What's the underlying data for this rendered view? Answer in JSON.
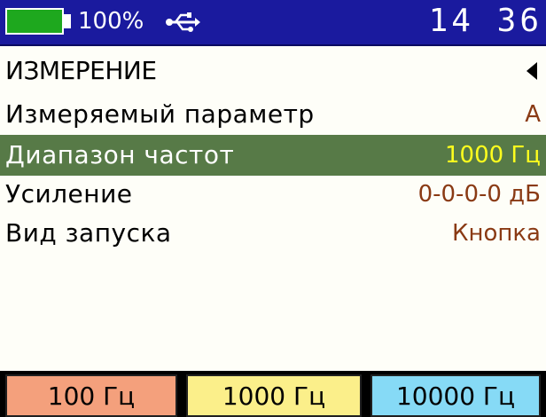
{
  "status_bar": {
    "battery_percent": "100%",
    "battery_level": 1.0,
    "usb_icon": "usb-icon",
    "clock": "14 36",
    "colors": {
      "background": "#1a1a9e",
      "battery": "#1ea81e"
    }
  },
  "menu": {
    "title": "ИЗМЕРЕНИЕ",
    "back_icon": "triangle-left-icon",
    "items": [
      {
        "label": "Измеряемый параметр",
        "value": "A",
        "selected": false
      },
      {
        "label": "Диапазон частот",
        "value": "1000 Гц",
        "selected": true
      },
      {
        "label": "Усиление",
        "value": "0-0-0-0 дБ",
        "selected": false
      },
      {
        "label": "Вид запуска",
        "value": "Кнопка",
        "selected": false
      }
    ],
    "colors": {
      "selected_row": "#577a47",
      "selected_value": "#ffff1e",
      "value": "#8a3a14"
    }
  },
  "softkeys": [
    {
      "label": "100 Гц",
      "color": "#f4a07c"
    },
    {
      "label": "1000 Гц",
      "color": "#fbef8a"
    },
    {
      "label": "10000 Гц",
      "color": "#86daf6"
    }
  ]
}
